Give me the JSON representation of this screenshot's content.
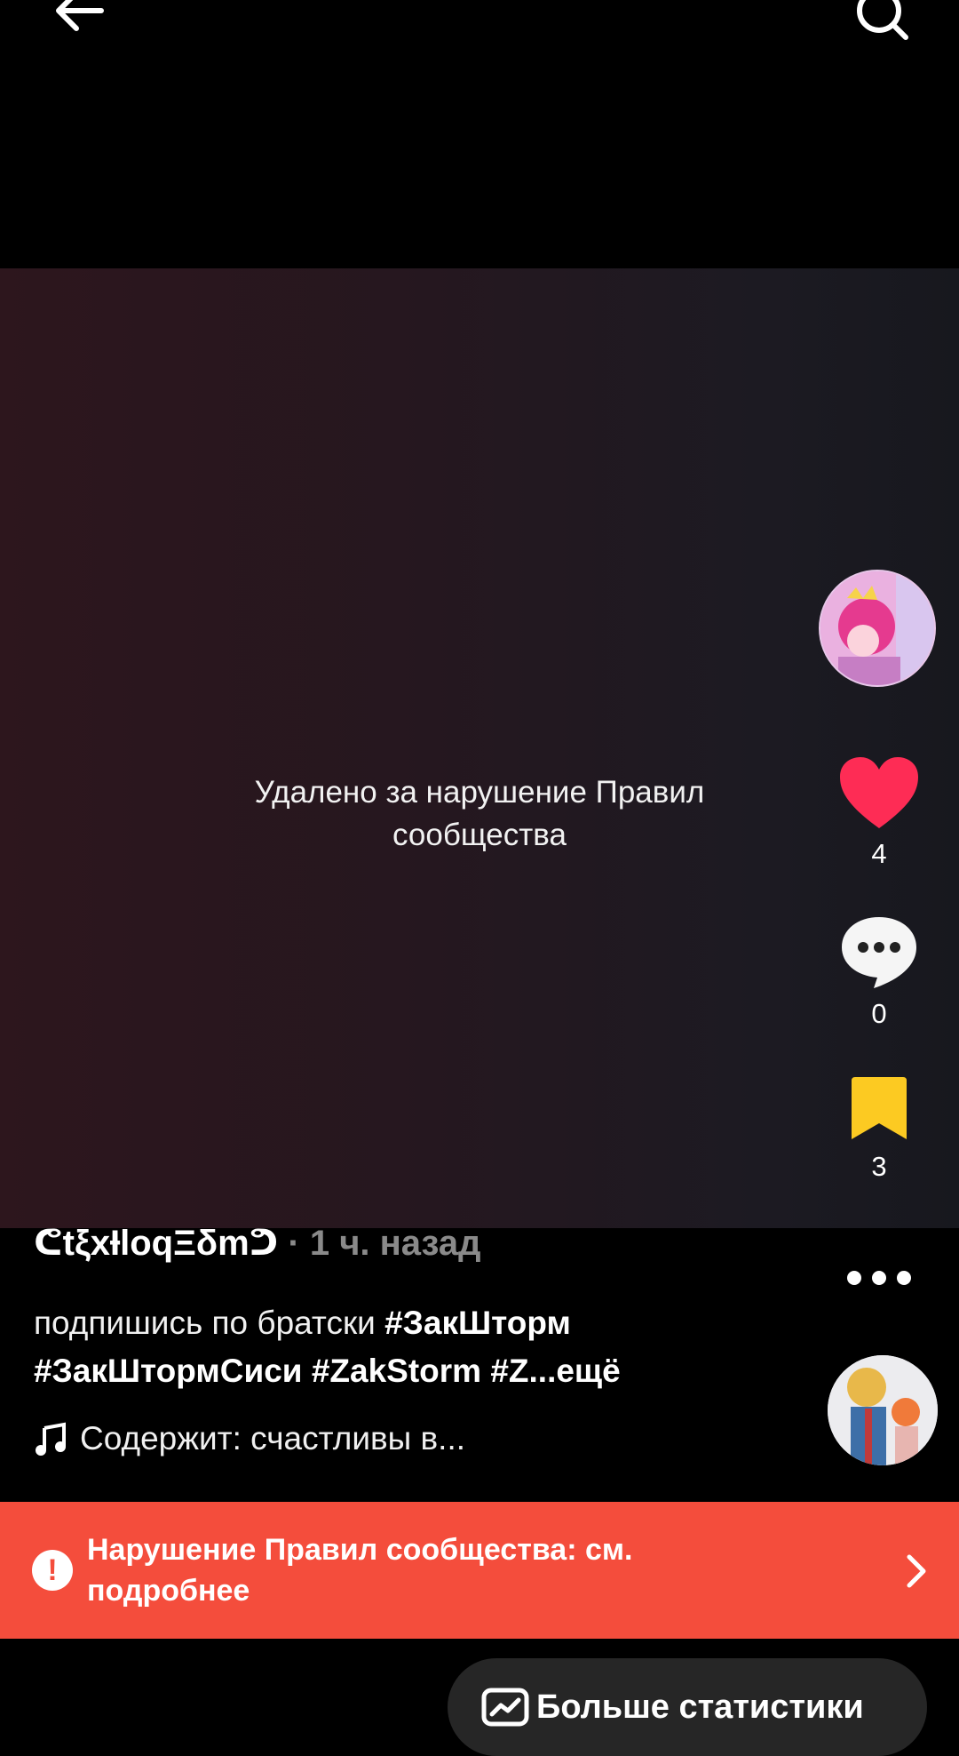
{
  "video": {
    "removed_message": "Удалено за нарушение Правил сообщества"
  },
  "rail": {
    "likes": "4",
    "comments": "0",
    "saves": "3"
  },
  "caption": {
    "username": "ᕦtξxƗloqΞδmᕤ",
    "separator": " · ",
    "time": "1 ч. назад",
    "text_plain": "подпишись по братски ",
    "hashtags": "#ЗакШторм #ЗакШтормСиси #ZakStorm #Z",
    "more": "...ещё",
    "music": "Содержит: счастливы в..."
  },
  "violation": {
    "text": "Нарушение Правил сообщества: см. подробнее"
  },
  "stats": {
    "label": "Больше статистики"
  },
  "colors": {
    "like": "#fe2c55",
    "save": "#fcca22",
    "banner": "#f44d3c"
  },
  "icons": {
    "back": "arrow-left-icon",
    "search": "search-icon",
    "like": "heart-icon",
    "comment": "comment-icon",
    "save": "bookmark-icon",
    "more": "more-dots-icon",
    "music": "music-note-icon",
    "warning": "exclamation-icon",
    "chevron": "chevron-right-icon",
    "stats": "trend-chart-icon"
  }
}
